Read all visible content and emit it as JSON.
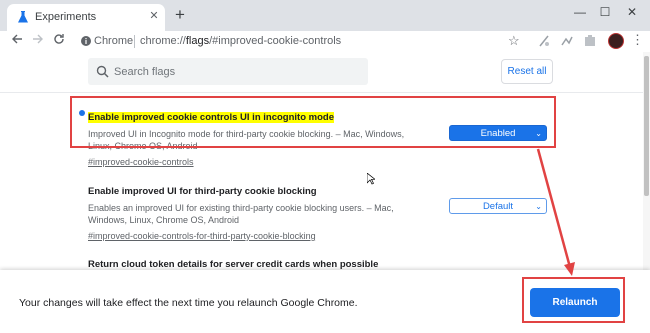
{
  "browser": {
    "tab": {
      "title": "Experiments",
      "icon": "flask-icon",
      "close": "✕"
    },
    "new_tab": "+",
    "window_controls": {
      "minimize": "—",
      "maximize": "☐",
      "close": "✕"
    },
    "omnibox": {
      "chip": "Chrome",
      "url_prefix": "chrome://",
      "url_host": "flags",
      "url_rest": "/#improved-cookie-controls"
    }
  },
  "flags_page": {
    "search": {
      "placeholder": "Search flags"
    },
    "reset_label": "Reset all",
    "flags": [
      {
        "title": "Enable improved cookie controls UI in incognito mode",
        "description": "Improved UI in Incognito mode for third-party cookie blocking. – Mac, Windows, Linux, Chrome OS, Android",
        "link": "#improved-cookie-controls",
        "value": "Enabled",
        "highlighted": true
      },
      {
        "title": "Enable improved UI for third-party cookie blocking",
        "description": "Enables an improved UI for existing third-party cookie blocking users. – Mac, Windows, Linux, Chrome OS, Android",
        "link": "#improved-cookie-controls-for-third-party-cookie-blocking",
        "value": "Default"
      },
      {
        "title": "Return cloud token details for server credit cards when possible"
      }
    ]
  },
  "relaunch": {
    "message": "Your changes will take effect the next time you relaunch Google Chrome.",
    "button": "Relaunch"
  },
  "colors": {
    "accent": "#1a73e8",
    "annotation": "#e14343",
    "highlight": "#ffff00"
  }
}
